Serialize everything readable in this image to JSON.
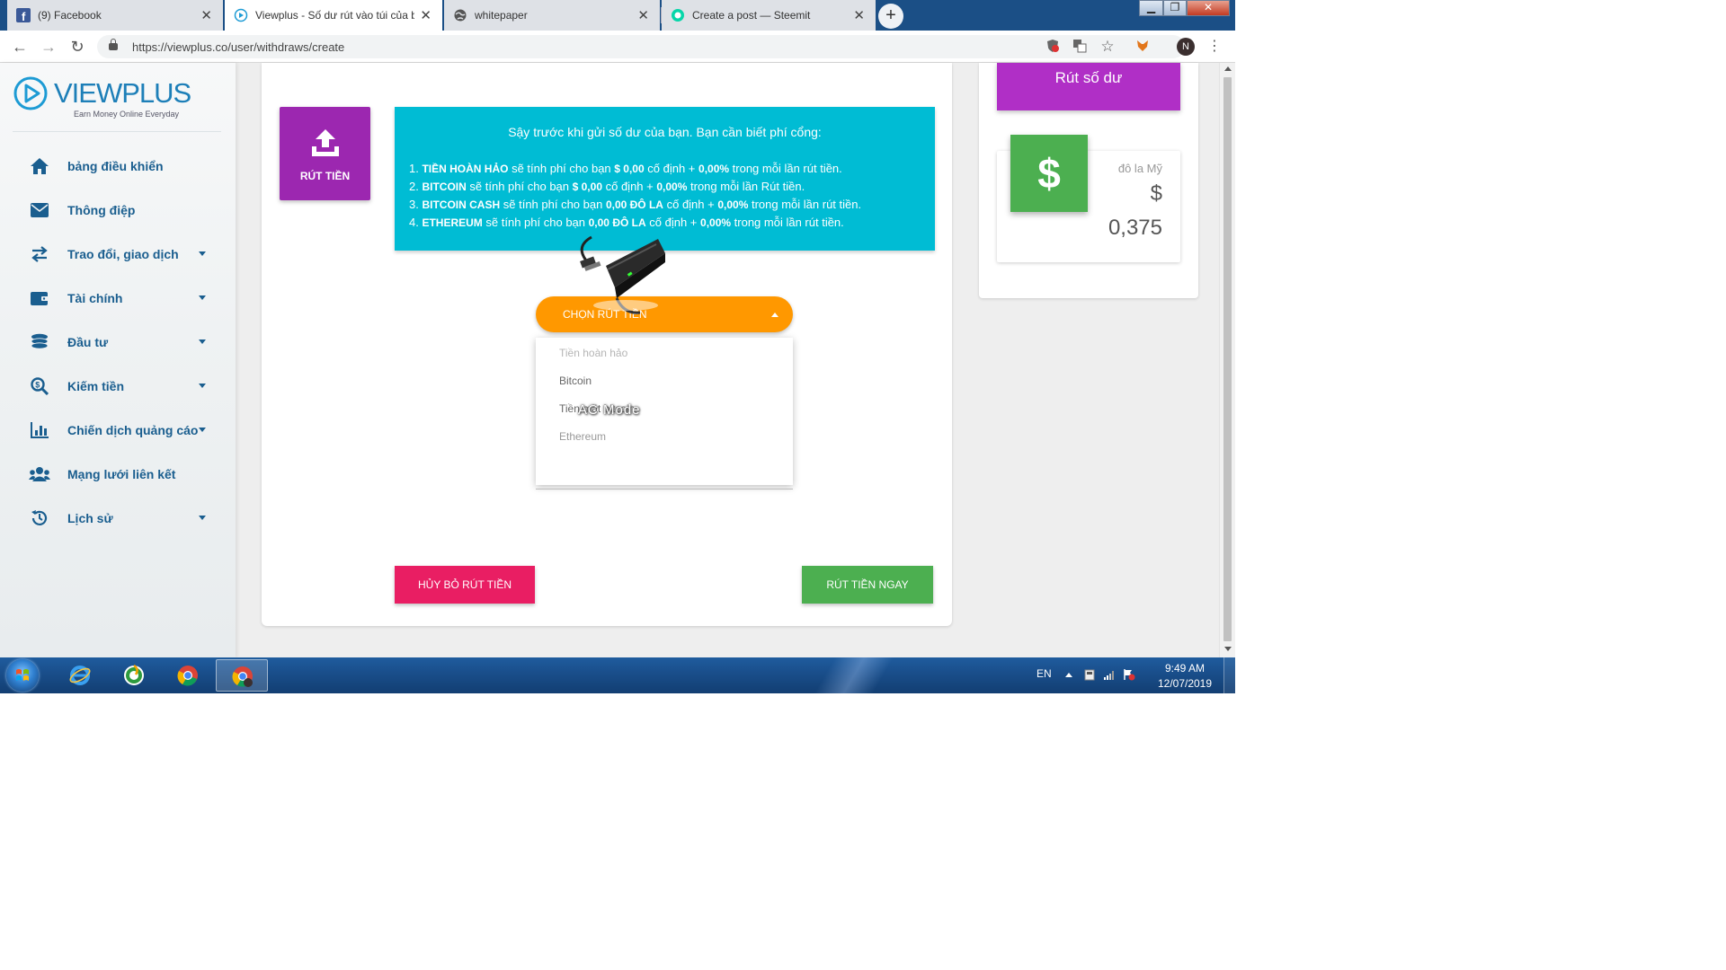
{
  "browser": {
    "tabs": [
      {
        "label": "(9) Facebook",
        "icon": "facebook-icon",
        "active": false
      },
      {
        "label": "Viewplus - Số dư rút vào túi của b",
        "icon": "viewplus-icon",
        "active": true
      },
      {
        "label": "whitepaper",
        "icon": "globe-icon",
        "active": false
      },
      {
        "label": "Create a post — Steemit",
        "icon": "steemit-icon",
        "active": false
      }
    ],
    "url": "https://viewplus.co/user/withdraws/create",
    "profile_initial": "N"
  },
  "logo": {
    "name": "VIEWPLUS",
    "tagline": "Earn Money Online Everyday"
  },
  "sidebar": {
    "items": [
      {
        "label": "bảng điều khiển",
        "icon": "home-icon",
        "has_submenu": false
      },
      {
        "label": "Thông điệp",
        "icon": "envelope-icon",
        "has_submenu": false
      },
      {
        "label": "Trao đổi, giao dịch",
        "icon": "exchange-icon",
        "has_submenu": true
      },
      {
        "label": "Tài chính",
        "icon": "wallet-icon",
        "has_submenu": true
      },
      {
        "label": "Đầu tư",
        "icon": "coins-icon",
        "has_submenu": true
      },
      {
        "label": "Kiếm tiền",
        "icon": "search-dollar-icon",
        "has_submenu": true
      },
      {
        "label": "Chiến dịch quảng cáo",
        "icon": "bar-chart-icon",
        "has_submenu": true
      },
      {
        "label": "Mạng lưới liên kết",
        "icon": "users-icon",
        "has_submenu": false
      },
      {
        "label": "Lịch sử",
        "icon": "history-icon",
        "has_submenu": true
      }
    ]
  },
  "withdraw": {
    "tile_label": "RÚT TIỀN",
    "fee_title": "Sậy trước khi gửi số dư của bạn. Bạn cần biết phí cổng:",
    "fees": [
      {
        "num": "1. ",
        "method": "TIỀN HOÀN HẢO",
        "t1": " sẽ tính phí cho bạn ",
        "fixed": "$ 0,00",
        "t2": " cố định + ",
        "pct": "0,00%",
        "t3": " trong mỗi lần rút tiền."
      },
      {
        "num": "2. ",
        "method": "BITCOIN",
        "t1": " sẽ tính phí cho bạn ",
        "fixed": "$ 0,00",
        "t2": " cố định + ",
        "pct": "0,00%",
        "t3": " trong mỗi lần Rút tiền."
      },
      {
        "num": "3. ",
        "method": "BITCOIN CASH",
        "t1": " sẽ tính phí cho bạn ",
        "fixed": "0,00 ĐÔ LA",
        "t2": " cố định + ",
        "pct": "0,00%",
        "t3": " trong mỗi lần rút tiền."
      },
      {
        "num": "4. ",
        "method": "ETHEREUM",
        "t1": " sẽ tính phí cho bạn ",
        "fixed": "0,00 ĐÔ LA",
        "t2": " cố định + ",
        "pct": "0,00%",
        "t3": " trong mỗi lần rút tiền."
      }
    ],
    "dropdown_label": "CHỌN RÚT TIỀN",
    "options": [
      "Tiền hoàn hảo",
      "Bitcoin",
      "Tiền mặt bitcoin",
      "Ethereum"
    ],
    "watermark": "AC Mode",
    "cancel_label": "HỦY BỎ RÚT TIỀN",
    "submit_label": "RÚT TIỀN NGAY"
  },
  "balance": {
    "button_label": "Rút số dư",
    "currency_name": "đô la Mỹ",
    "currency_symbol": "$",
    "amount": "0,375"
  },
  "taskbar": {
    "language": "EN",
    "time": "9:49 AM",
    "date": "12/07/2019"
  },
  "colors": {
    "sidebar_text": "#1a5e8f",
    "withdraw_tile": "#9c27b0",
    "fee_box": "#00bcd4",
    "dropdown": "#ff9800",
    "cancel": "#e91e63",
    "submit": "#4caf50",
    "balance_button": "#b02fc6"
  }
}
